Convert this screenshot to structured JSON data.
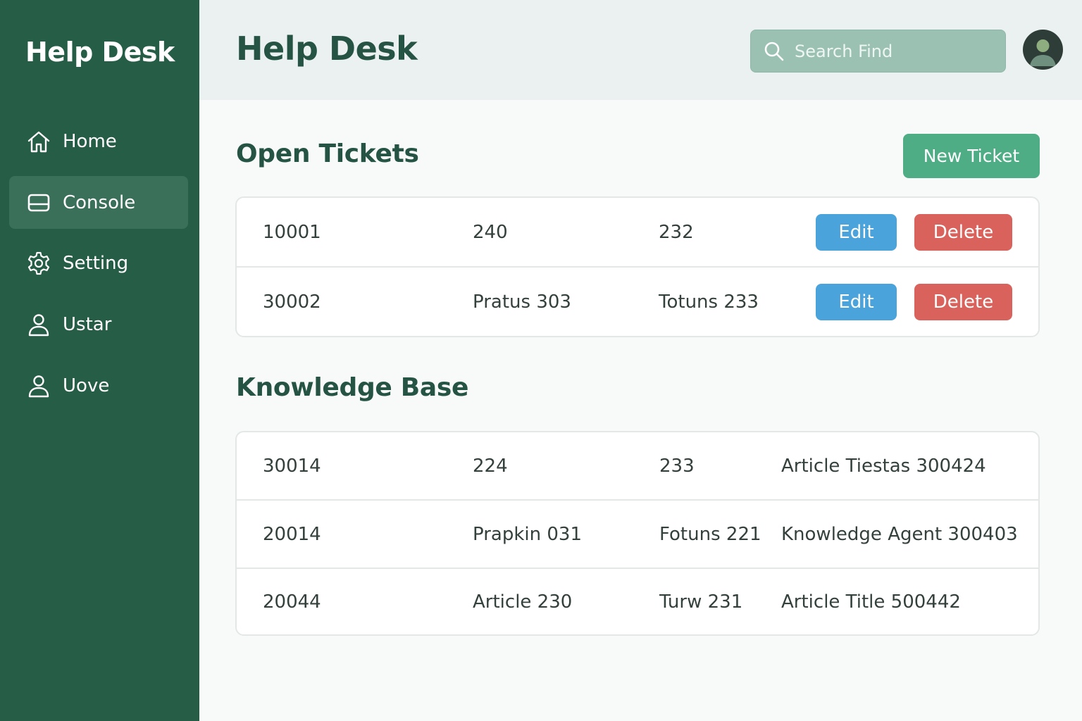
{
  "sidebar": {
    "brand": "Help Desk",
    "items": [
      {
        "label": "Home",
        "icon": "home-icon",
        "active": false
      },
      {
        "label": "Console",
        "icon": "console-icon",
        "active": true
      },
      {
        "label": "Setting",
        "icon": "gear-icon",
        "active": false
      },
      {
        "label": "Ustar",
        "icon": "user-icon",
        "active": false
      },
      {
        "label": "Uove",
        "icon": "user-icon",
        "active": false
      }
    ]
  },
  "header": {
    "title": "Help Desk",
    "search": {
      "placeholder": "Search Find",
      "icon": "search-icon"
    },
    "avatar_icon": "user-avatar"
  },
  "open_tickets": {
    "title": "Open Tickets",
    "new_ticket_label": "New Ticket",
    "edit_label": "Edit",
    "delete_label": "Delete",
    "rows": [
      [
        "10001",
        "240",
        "232"
      ],
      [
        "30002",
        "Pratus 303",
        "Totuns 233"
      ]
    ]
  },
  "knowledge_base": {
    "title": "Knowledge Base",
    "rows": [
      [
        "30014",
        "224",
        "233",
        "Article Tiestas 300424"
      ],
      [
        "20014",
        "Prapkin 031",
        "Fotuns 221",
        "Knowledge Agent 300403"
      ],
      [
        "20044",
        "Article 230",
        "Turw 231",
        "Article Title 500442"
      ]
    ]
  },
  "colors": {
    "sidebar_bg": "#265d47",
    "accent_green": "#4fad86",
    "edit_blue": "#4aa3da",
    "delete_red": "#d9635c"
  }
}
